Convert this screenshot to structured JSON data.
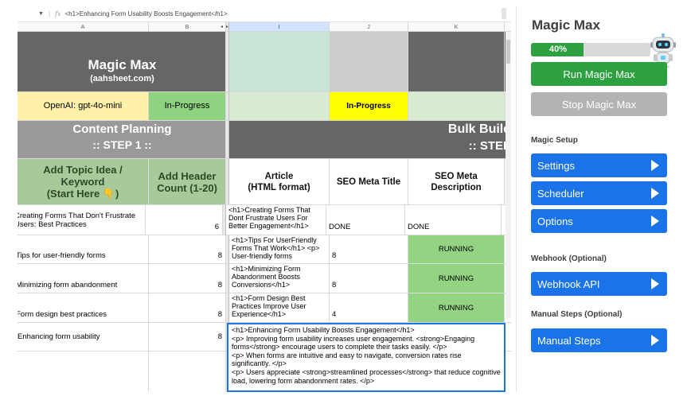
{
  "formula_bar": {
    "dropdown_glyph": "▼",
    "fx_label": "fx",
    "content": "<h1>Enhancing Form Usability Boosts Engagement</h1>"
  },
  "columns": [
    {
      "label": "A"
    },
    {
      "label": "B"
    },
    {
      "label": ""
    },
    {
      "label": "I"
    },
    {
      "label": "J"
    },
    {
      "label": "K"
    },
    {
      "label": ""
    }
  ],
  "sheet": {
    "brand_title": "Magic Max",
    "brand_subtitle": "(aahsheet.com)",
    "model_label": "OpenAI: gpt-4o-mini",
    "status_b": "In-Progress",
    "status_j": "In-Progress",
    "planning_title": "Content Planning",
    "planning_step": ":: STEP 1 ::",
    "bulk_title": "Bulk Build",
    "bulk_step": ":: STEP",
    "hdr_topic": "Add Topic Idea / Keyword (Start Here 👇)",
    "hdr_topic_l1": "Add Topic Idea /",
    "hdr_topic_l2": "Keyword",
    "hdr_topic_l3": "(Start Here 👇)",
    "hdr_count_l1": "Add Header",
    "hdr_count_l2": "Count (1-20)",
    "hdr_article_l1": "Article",
    "hdr_article_l2": "(HTML format)",
    "hdr_meta_title": "SEO Meta Title",
    "hdr_meta_desc_l1": "SEO Meta",
    "hdr_meta_desc_l2": "Description"
  },
  "rows": [
    {
      "topic_l1": "Creating Forms That Don't Frustrate",
      "topic_l2": "Users: Best Practices",
      "count": "6",
      "article": "<h1>Creating Forms That Dont Frustrate Users For Better Engagement</h1>",
      "meta_title": "DONE",
      "meta_desc": "DONE"
    },
    {
      "topic": "Tips for user-friendly forms",
      "count": "8",
      "article": "<h1>Tips For UserFriendly Forms That Work</h1> <p> User-friendly forms",
      "meta_title": "8",
      "meta_desc": "RUNNING"
    },
    {
      "topic": "Minimizing form abandonment",
      "count": "8",
      "article": "<h1>Minimizing Form Abandonment Boosts Conversions</h1>",
      "meta_title": "8",
      "meta_desc": "RUNNING"
    },
    {
      "topic": "Form design best practices",
      "count": "8",
      "article": "<h1>Form Design Best Practices Improve User Experience</h1>",
      "meta_title": "4",
      "meta_desc": "RUNNING"
    },
    {
      "topic": "Enhancing form usability",
      "count": "8"
    }
  ],
  "editor": {
    "line1": "<h1>Enhancing Form Usability Boosts Engagement</h1>",
    "line2": "<p> Improving form usability increases user engagement. <strong>Engaging forms</strong> encourage users to complete their tasks easily. </p>",
    "line3": "<p> When forms are intuitive and easy to navigate, conversion rates rise significantly. </p>",
    "line4": "<p> Users appreciate <strong>streamlined processes</strong> that reduce cognitive load, lowering form abandonment rates. </p>"
  },
  "sidebar": {
    "title": "Magic Max",
    "progress_label": "40%",
    "progress_value": 0.4,
    "run_button": "Run Magic Max",
    "stop_button": "Stop Magic Max",
    "section_setup": "Magic Setup",
    "settings": "Settings",
    "scheduler": "Scheduler",
    "options": "Options",
    "section_webhook": "Webhook (Optional)",
    "webhook_api": "Webhook API",
    "section_manual": "Manual Steps (Optional)",
    "manual_steps": "Manual Steps",
    "robot_icon": "robot-mascot-icon",
    "play_icon": "play-triangle-icon"
  },
  "colors": {
    "run": "#2da140",
    "stop": "#b3b3b3",
    "nav": "#1a73e8",
    "running": "#93d382",
    "in_progress_yellow": "#ffff00"
  }
}
